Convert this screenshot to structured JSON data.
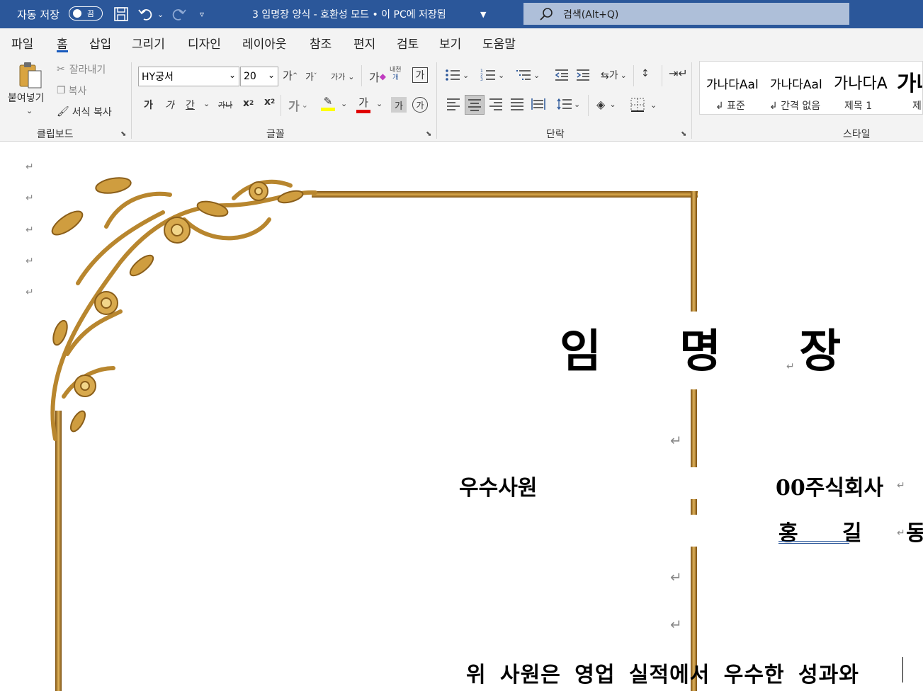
{
  "titlebar": {
    "autosave_label": "자동 저장",
    "autosave_state": "끔",
    "document_title": "3 임명장 양식  -  호환성 모드 • 이 PC에 저장됨",
    "search_placeholder": "검색(Alt+Q)"
  },
  "menu": {
    "items": [
      "파일",
      "홈",
      "삽입",
      "그리기",
      "디자인",
      "레이아웃",
      "참조",
      "편지",
      "검토",
      "보기",
      "도움말"
    ],
    "active": "홈"
  },
  "ribbon": {
    "clipboard": {
      "paste": "붙여넣기",
      "cut": "잘라내기",
      "copy": "복사",
      "format_painter": "서식 복사",
      "label": "클립보드"
    },
    "font": {
      "font_name": "HY궁서",
      "font_size": "20",
      "label": "글꼴",
      "bold": "가",
      "italic": "가",
      "underline": "간",
      "strike": "가나",
      "grow": "가",
      "shrink": "가",
      "case": "가가",
      "phonetic": "가",
      "enclose": "내천",
      "charborder": "가",
      "texteffect": "가",
      "fontcolor": "가",
      "shading": "가",
      "circled": "⑭"
    },
    "paragraph": {
      "label": "단락"
    },
    "styles": {
      "label": "스타일",
      "items": [
        {
          "sample": "가나다Aal",
          "name": "↲ 표준"
        },
        {
          "sample": "가나다Aal",
          "name": "↲ 간격 없음"
        },
        {
          "sample": "가나다A",
          "name": "제목 1"
        },
        {
          "sample": "가나",
          "name": "제"
        }
      ]
    },
    "colors": {
      "highlight": "#ffff00",
      "fontcolor": "#e00000"
    }
  },
  "document": {
    "title": "임 명 장",
    "position": "우수사원",
    "company": "00주식회사",
    "name": "홍 길 동",
    "body": "위 사원은 영업 실적에서 우수한 성과와"
  },
  "colors": {
    "accent": "#2b579a",
    "gold": "#b8862e"
  }
}
